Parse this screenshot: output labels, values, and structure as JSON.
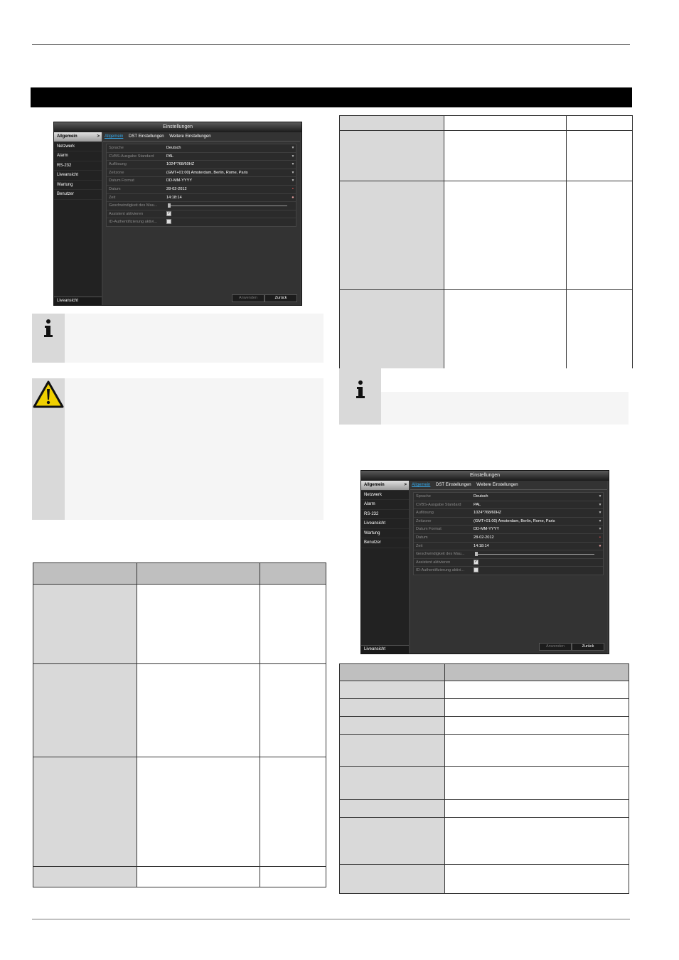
{
  "dvr": {
    "title": "Einstellungen",
    "sidebar": [
      "Allgemein",
      "Netzwerk",
      "Alarm",
      "RS-232",
      "Liveansicht",
      "Wartung",
      "Benutzer"
    ],
    "sidebar_bottom": "Liveansicht",
    "tabs": [
      "Allgemein",
      "DST Einstellungen",
      "Weitere Einstellungen"
    ],
    "fields": {
      "sprache": {
        "label": "Sprache",
        "value": "Deutsch"
      },
      "cvbs": {
        "label": "CVBS-Ausgabe Standard",
        "value": "PAL"
      },
      "aufloesung": {
        "label": "Auflösung",
        "value": "1024*768/60HZ"
      },
      "zeitzone": {
        "label": "Zeitzone",
        "value": "(GMT+01:00) Amsterdam, Berlin, Rome, Paris"
      },
      "datum_format": {
        "label": "Datum Format",
        "value": "DD-MM-YYYY"
      },
      "datum": {
        "label": "Datum",
        "value": "28-02-2012"
      },
      "zeit": {
        "label": "Zeit",
        "value": "14:18:14"
      },
      "maus": {
        "label": "Geschwindigkeit des Mau..."
      },
      "assistent": {
        "label": "Assistent aktivieren"
      },
      "id_auth": {
        "label": "ID-Authentifizierung aktivi..."
      }
    },
    "btn_apply": "Anwenden",
    "btn_back": "Zurück"
  }
}
